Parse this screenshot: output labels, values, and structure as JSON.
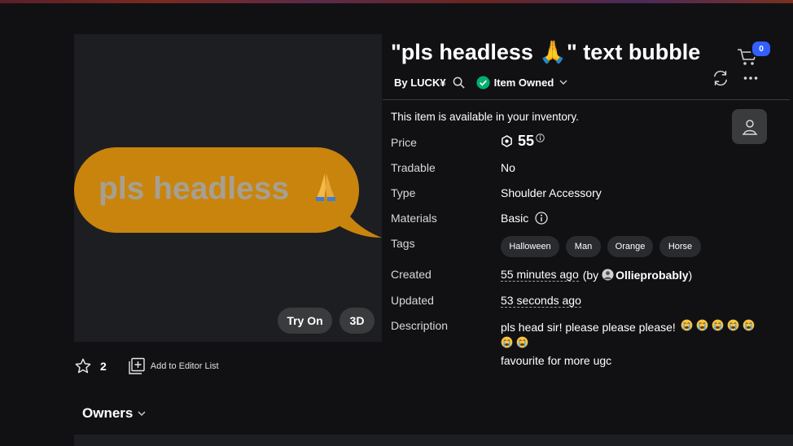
{
  "item": {
    "title": "\"pls headless 🙏\" text bubble",
    "thumbnail_text": "pls headless",
    "by_label": "By LUCK¥",
    "owned_label": "Item Owned",
    "availability": "This item is available in your inventory."
  },
  "thumbnail": {
    "try_on": "Try On",
    "view_3d": "3D"
  },
  "favorites": {
    "count": "2",
    "editor_list": "Add to Editor List"
  },
  "owners": {
    "label": "Owners"
  },
  "cart": {
    "count": "0"
  },
  "details": {
    "price_label": "Price",
    "price_value": "55",
    "tradable_label": "Tradable",
    "tradable_value": "No",
    "type_label": "Type",
    "type_value": "Shoulder Accessory",
    "materials_label": "Materials",
    "materials_value": "Basic",
    "tags_label": "Tags",
    "tags": [
      "Halloween",
      "Man",
      "Orange",
      "Horse"
    ],
    "created_label": "Created",
    "created_value": "55 minutes ago",
    "created_by_prefix": "(by ",
    "created_by": "Ollieprobably",
    "created_by_suffix": ")",
    "updated_label": "Updated",
    "updated_value": "53 seconds ago",
    "description_label": "Description",
    "description_line1": "pls head sir! please please please!",
    "description_line3": "favourite for more ugc"
  },
  "colors": {
    "accent_blue": "#335fff",
    "owned_green": "#00b06f",
    "bubble_orange": "#c9840d"
  }
}
